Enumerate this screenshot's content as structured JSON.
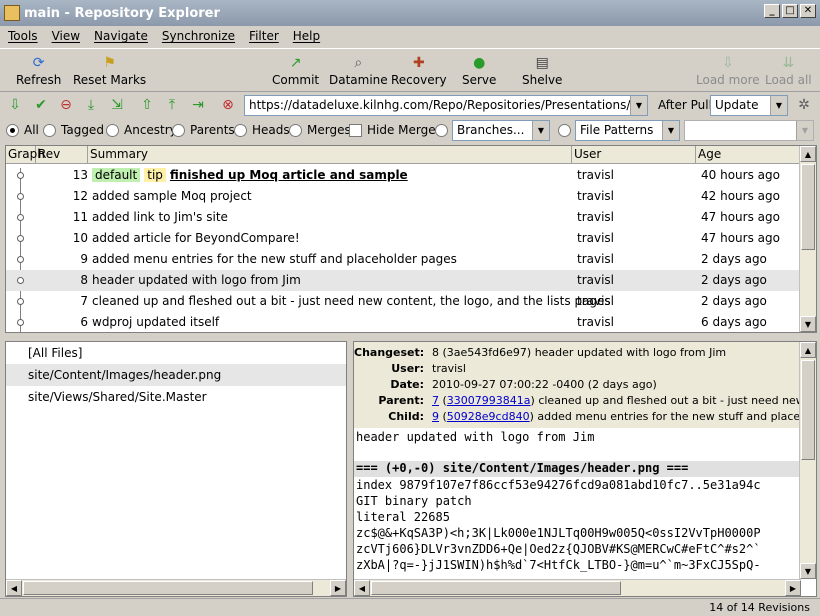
{
  "window": {
    "title": "main - Repository Explorer",
    "controls": [
      "_",
      "□",
      "✕"
    ]
  },
  "menu": [
    "Tools",
    "View",
    "Navigate",
    "Synchronize",
    "Filter",
    "Help"
  ],
  "toolbar": {
    "refresh": "Refresh",
    "reset_marks": "Reset Marks",
    "commit": "Commit",
    "datamine": "Datamine",
    "recovery": "Recovery",
    "serve": "Serve",
    "shelve": "Shelve",
    "load_more": "Load more",
    "load_all": "Load all"
  },
  "nav": {
    "url": "https://datadeluxe.kilnhg.com/Repo/Repositories/Presentations/TTTTTT",
    "after_pull_label": "After Pull:",
    "after_pull_value": "Update"
  },
  "filter": {
    "all": "All",
    "tagged": "Tagged",
    "ancestry": "Ancestry",
    "parents": "Parents",
    "heads": "Heads",
    "merges": "Merges",
    "hide_merges": "Hide Merges",
    "branches": "Branches...",
    "file_patterns": "File Patterns",
    "pattern_value": ""
  },
  "grid": {
    "columns": [
      "Graph",
      "Rev",
      "Summary",
      "User",
      "Age"
    ],
    "rows": [
      {
        "rev": "13",
        "tags": [
          "default",
          "tip"
        ],
        "summary": "finished up Moq article and sample",
        "user": "travisl",
        "age": "40 hours ago",
        "bold": true
      },
      {
        "rev": "12",
        "tags": [],
        "summary": "added sample Moq project",
        "user": "travisl",
        "age": "42 hours ago"
      },
      {
        "rev": "11",
        "tags": [],
        "summary": "added link to Jim's site",
        "user": "travisl",
        "age": "47 hours ago"
      },
      {
        "rev": "10",
        "tags": [],
        "summary": "added article for BeyondCompare!",
        "user": "travisl",
        "age": "47 hours ago"
      },
      {
        "rev": "9",
        "tags": [],
        "summary": "added menu entries for the new stuff and placeholder pages",
        "user": "travisl",
        "age": "2 days ago"
      },
      {
        "rev": "8",
        "tags": [],
        "summary": "header updated with logo from Jim",
        "user": "travisl",
        "age": "2 days ago",
        "selected": true
      },
      {
        "rev": "7",
        "tags": [],
        "summary": "cleaned up and fleshed out a bit - just need new content, the logo, and the lists pages",
        "user": "travisl",
        "age": "2 days ago"
      },
      {
        "rev": "6",
        "tags": [],
        "summary": "wdproj updated itself",
        "user": "travisl",
        "age": "6 days ago"
      }
    ]
  },
  "files": [
    "[All Files]",
    "site/Content/Images/header.png",
    "site/Views/Shared/Site.Master"
  ],
  "details": {
    "changeset_label": "Changeset:",
    "changeset": "8 (3ae543fd6e97) header updated with logo from Jim",
    "user_label": "User:",
    "user": "travisl",
    "date_label": "Date:",
    "date": "2010-09-27 07:00:22 -0400 (2 days ago)",
    "parent_label": "Parent:",
    "parent_rev": "7",
    "parent_hash": "33007993841a",
    "parent_text": "cleaned up and fleshed out a bit - just need new conte",
    "child_label": "Child:",
    "child_rev": "9",
    "child_hash": "50928e9cd840",
    "child_text": "added menu entries for the new stuff and placeholder",
    "message": "header updated with logo from Jim",
    "diff_header": "=== (+0,-0) site/Content/Images/header.png ===",
    "diff_lines": [
      "index 9879f107e7f86ccf53e94276fcd9a081abd10fc7..5e31a94c",
      "GIT binary patch",
      "literal 22685",
      "zc$@&+KqSA3P)<h;3K|Lk000e1NJLTq00H9w005Q<0ssI2VvTpH0000P",
      "zcVTj606}DLVr3vnZDD6+Qe|Oed2z{QJOBV#KS@MERCwC#eFtC^#s2^`",
      "zXbA|?q=-}jJ1SWIN)h$h%d`7<HtfCk_LTBO-}@m=u^`m~3FxCJ5SpQ-"
    ]
  },
  "status": "14 of 14 Revisions"
}
